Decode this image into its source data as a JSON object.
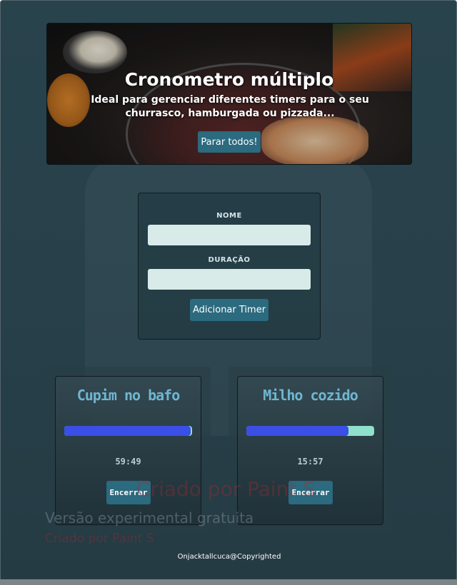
{
  "hero": {
    "title": "Cronometro múltiplo",
    "subtitle": "Ideal para gerenciar diferentes timers para o seu churrasco, hamburgada ou pizzada...",
    "stop_all_label": "Parar todos!"
  },
  "form": {
    "name_label": "NOME",
    "name_value": "",
    "duration_label": "DURAÇÃO",
    "duration_value": "",
    "add_label": "Adicionar Timer"
  },
  "timers": [
    {
      "name": "Cupim no bafo",
      "time": "59:49",
      "progress": 0.99,
      "end_label": "Encerrar"
    },
    {
      "name": "Milho cozido",
      "time": "15:57",
      "progress": 0.8,
      "end_label": "Encerrar"
    }
  ],
  "watermark": {
    "line1": "Criado por Paint S",
    "line2": "Versão experimental gratuita",
    "line3": "Criado por Paint S"
  },
  "footer": "Onjacktallcuca@Copyrighted",
  "colors": {
    "background": "#27404a",
    "button": "#2b6a7f",
    "progress_fill": "#3b4ee6",
    "progress_track": "#8fe0cc",
    "timer_title": "#6fb6d2"
  }
}
